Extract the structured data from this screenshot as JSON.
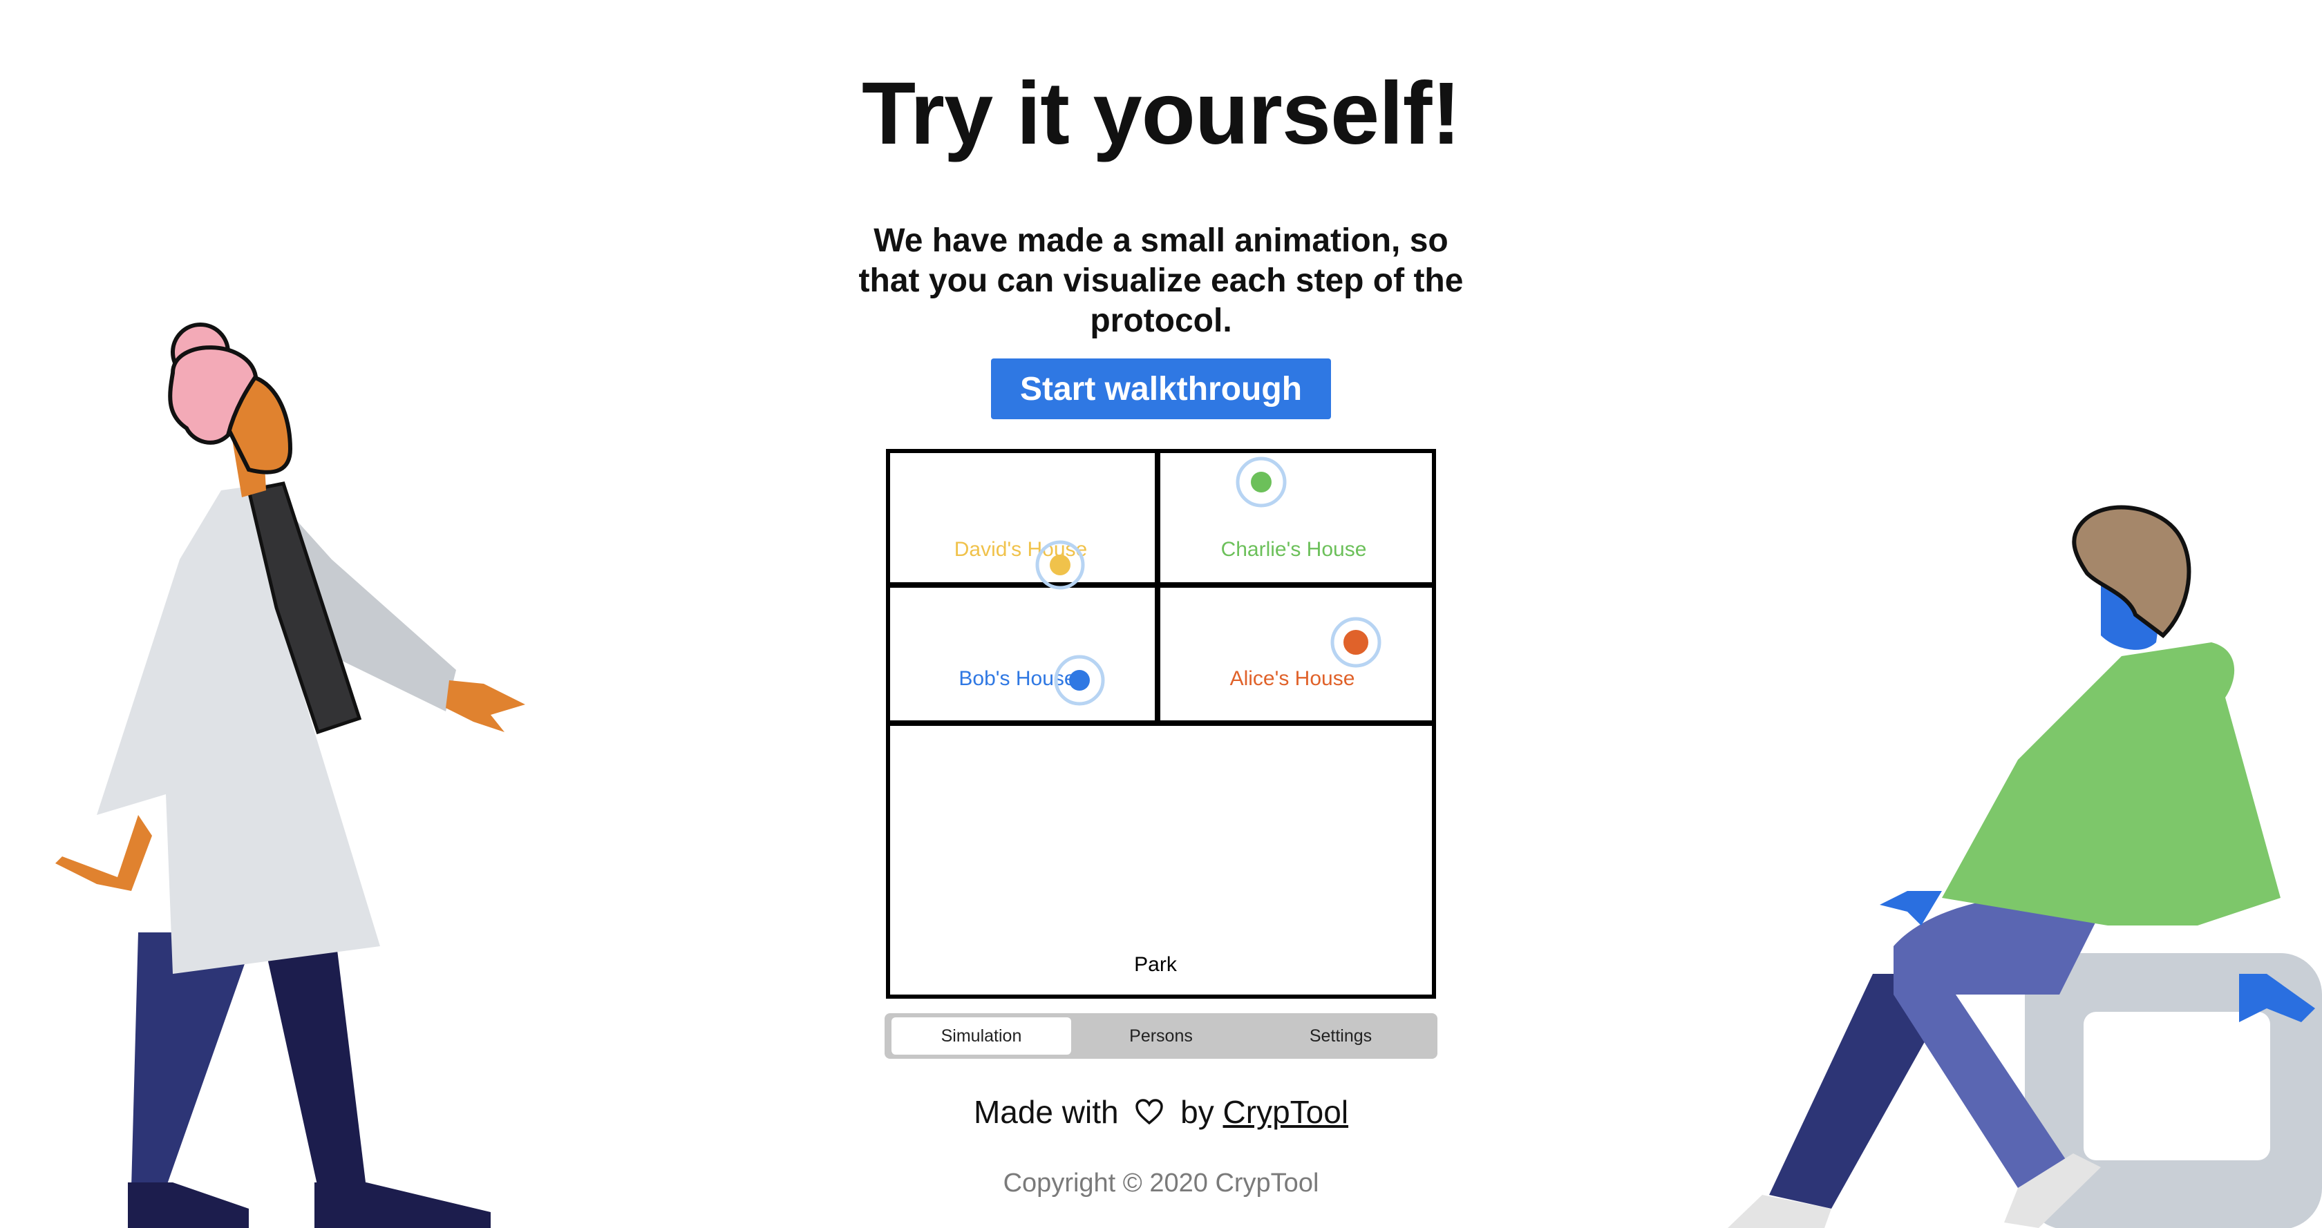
{
  "hero": {
    "title": "Try it yourself!",
    "subtitle": "We have made a small animation, so that you can visualize each step of the protocol.",
    "start_button": "Start walkthrough"
  },
  "map": {
    "houses": [
      {
        "id": "david",
        "label": "David's House",
        "color": "#f0c24b"
      },
      {
        "id": "charlie",
        "label": "Charlie's House",
        "color": "#6cc05a"
      },
      {
        "id": "bob",
        "label": "Bob's House",
        "color": "#2f78e3"
      },
      {
        "id": "alice",
        "label": "Alice's House",
        "color": "#e0622a"
      }
    ],
    "park_label": "Park"
  },
  "tabs": [
    {
      "label": "Simulation",
      "active": true
    },
    {
      "label": "Persons",
      "active": false
    },
    {
      "label": "Settings",
      "active": false
    }
  ],
  "footer": {
    "made_with_prefix": "Made with",
    "made_with_suffix": "by",
    "brand_link": "CrypTool",
    "copyright": "Copyright © 2020 CrypTool"
  },
  "colors": {
    "accent": "#2f78e3",
    "tab_bar": "#c6c6c6"
  }
}
